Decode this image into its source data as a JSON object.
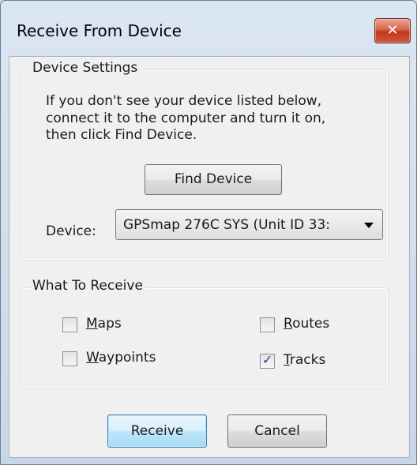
{
  "window": {
    "title": "Receive From Device",
    "close_icon": "close-icon",
    "close_glyph": "✕",
    "close_color": "#c0371b"
  },
  "device_settings": {
    "title": "Device Settings",
    "message_line1": "If you don't see your device listed below,",
    "message_line2": "connect it to the computer and turn it on,",
    "message_line3": "then click Find Device.",
    "find_button": "Find Device",
    "device_label": "Device:",
    "device_value": "GPSmap 276C SYS (Unit ID 33:",
    "dropdown_icon": "chevron-down-icon"
  },
  "what_to_receive": {
    "title": "What To Receive",
    "maps": {
      "label": "Maps",
      "checked": false
    },
    "waypoints": {
      "label": "Waypoints",
      "checked": false
    },
    "routes": {
      "label": "Routes",
      "checked": false
    },
    "tracks": {
      "label": "Tracks",
      "checked": true
    },
    "check_glyph": "✓"
  },
  "buttons": {
    "receive": "Receive",
    "cancel": "Cancel"
  }
}
